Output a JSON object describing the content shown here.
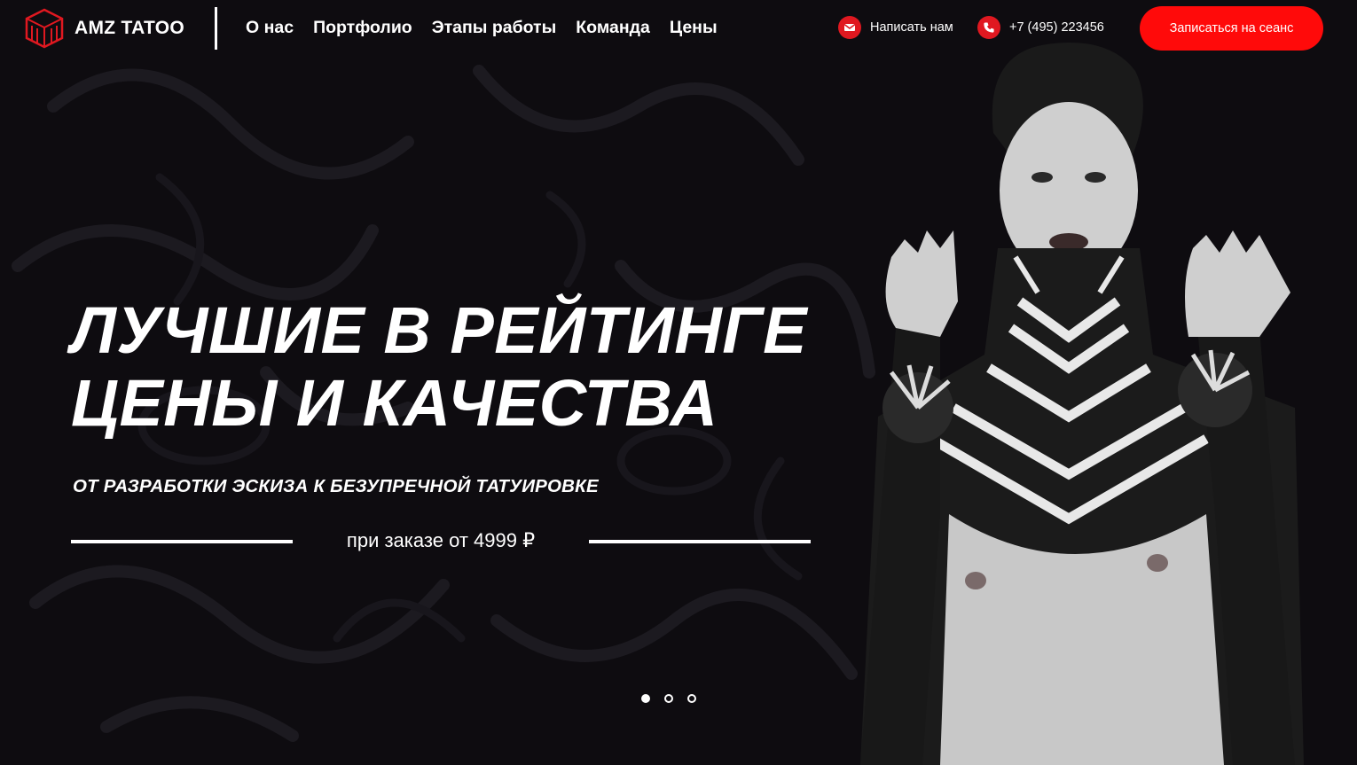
{
  "brand": {
    "name": "AMZ TATOO"
  },
  "nav": [
    {
      "label": "О нас"
    },
    {
      "label": "Портфолио"
    },
    {
      "label": "Этапы работы"
    },
    {
      "label": "Команда"
    },
    {
      "label": "Цены"
    }
  ],
  "contacts": {
    "write_label": "Написать нам",
    "phone": "+7 (495) 223456"
  },
  "cta_label": "Записаться на сеанс",
  "hero": {
    "headline_line1": "Лучшие в рейтинге",
    "headline_line2": "цены и качества",
    "subheadline": "ОТ РАЗРАБОТКИ ЭСКИЗА К БЕЗУПРЕЧНОЙ ТАТУИРОВКЕ",
    "price_note": "при заказе от 4999 ₽"
  },
  "slider": {
    "count": 3,
    "active_index": 0
  },
  "colors": {
    "background": "#0e0c10",
    "accent": "#ff0a0a",
    "icon_red": "#e01820"
  },
  "icons": {
    "logo": "hex-cube-logo-icon",
    "mail": "mail-icon",
    "phone": "phone-icon"
  }
}
